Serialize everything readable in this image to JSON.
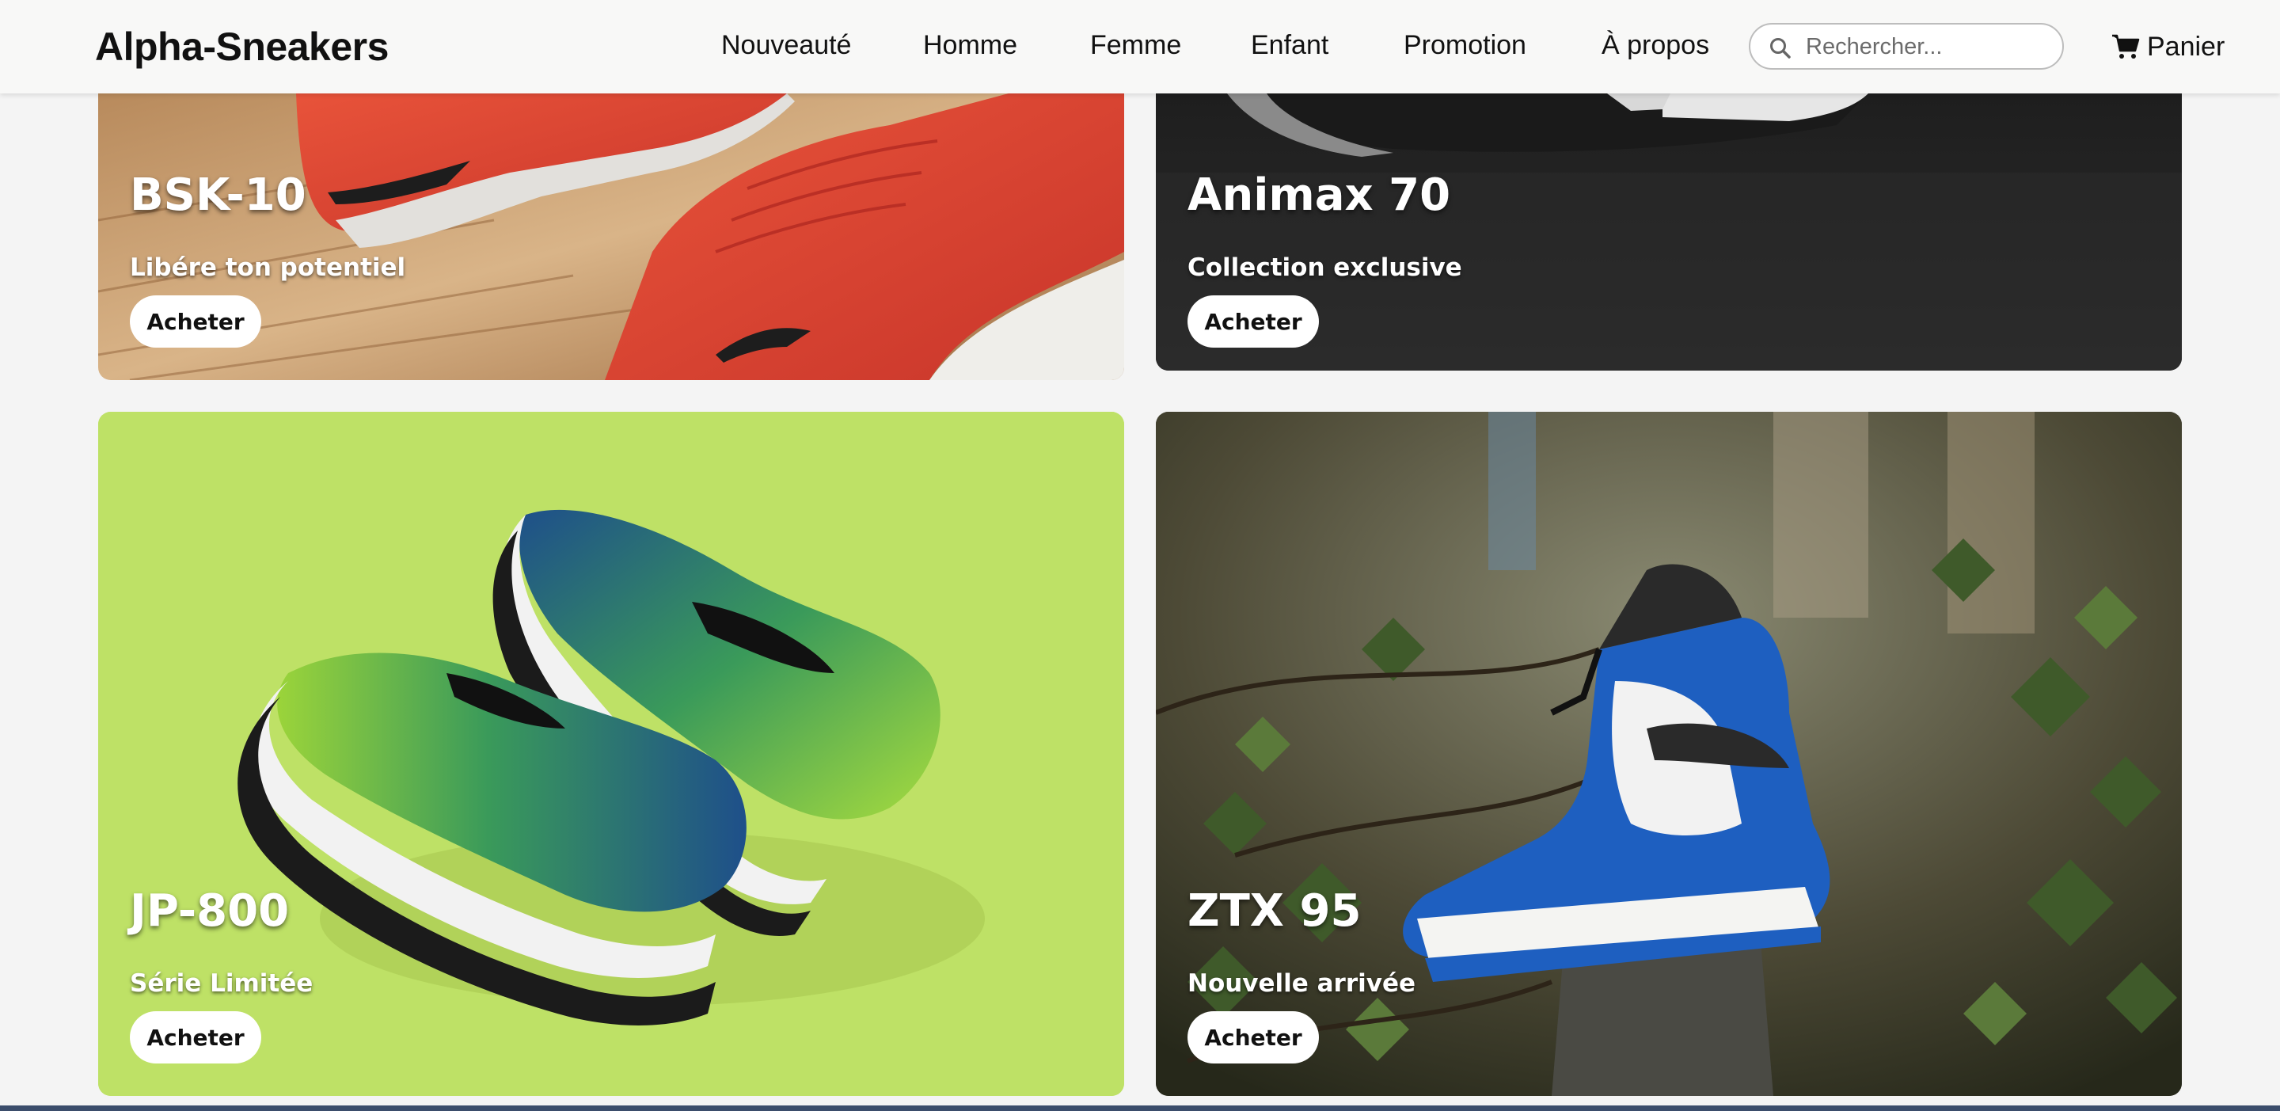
{
  "header": {
    "logo": "Alpha-Sneakers",
    "nav": [
      "Nouveauté",
      "Homme",
      "Femme",
      "Enfant",
      "Promotion",
      "À propos"
    ],
    "search_placeholder": "Rechercher...",
    "cart_label": "Panier"
  },
  "cards": [
    {
      "title": "BSK-10",
      "subtitle": "Libére ton potentiel",
      "button": "Acheter"
    },
    {
      "title": "Animax 70",
      "subtitle": "Collection exclusive",
      "button": "Acheter"
    },
    {
      "title": "JP-800",
      "subtitle": "Série Limitée",
      "button": "Acheter"
    },
    {
      "title": "ZTX 95",
      "subtitle": "Nouvelle arrivée",
      "button": "Acheter"
    }
  ],
  "icons": {
    "search": "search-icon",
    "cart": "cart-icon"
  },
  "colors": {
    "card3_background": "#bee166",
    "button_bg": "#ffffff",
    "header_bg": "#f8f8f7"
  }
}
